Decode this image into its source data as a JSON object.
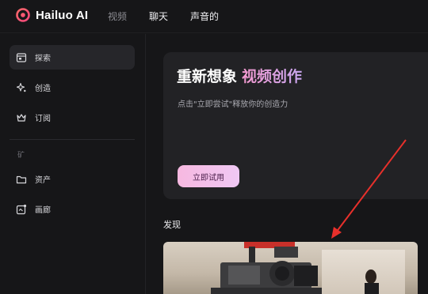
{
  "header": {
    "logo_text": "Hailuo AI",
    "tabs": [
      {
        "label": "视频"
      },
      {
        "label": "聊天"
      },
      {
        "label": "声音的"
      }
    ]
  },
  "sidebar": {
    "items": [
      {
        "label": "探索",
        "icon": "calendar-icon"
      },
      {
        "label": "创造",
        "icon": "sparkle-icon"
      },
      {
        "label": "订阅",
        "icon": "crown-icon"
      }
    ],
    "section_label": "矿",
    "section_items": [
      {
        "label": "资产",
        "icon": "folder-icon"
      },
      {
        "label": "画廊",
        "icon": "gallery-icon"
      }
    ]
  },
  "hero": {
    "title": "重新想象",
    "title_accent": "视频创作",
    "subtitle": "点击\"立即尝试\"释放你的创造力",
    "button_label": "立即试用"
  },
  "discover": {
    "heading": "发现"
  },
  "colors": {
    "background": "#161618",
    "card": "#222225",
    "accent_pink": "#f49ad0",
    "accent_purple": "#c9a6f0",
    "annotation_red": "#e8302b"
  }
}
